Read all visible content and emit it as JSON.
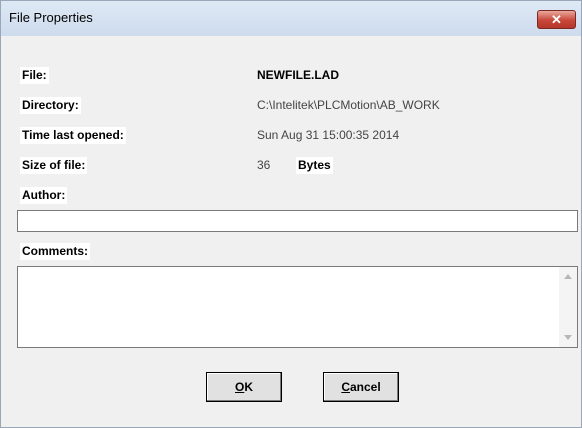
{
  "window": {
    "title": "File Properties",
    "close_glyph": "✕"
  },
  "fields": {
    "file_label": "File:",
    "file_value": "NEWFILE.LAD",
    "directory_label": "Directory:",
    "directory_value": "C:\\Intelitek\\PLCMotion\\AB_WORK",
    "time_label": "Time last opened:",
    "time_value": "Sun Aug 31 15:00:35 2014",
    "size_label": "Size of file:",
    "size_value": "36",
    "size_unit": "Bytes",
    "author_label": "Author:",
    "author_value": "",
    "comments_label": "Comments:",
    "comments_value": ""
  },
  "buttons": {
    "ok_mnemonic": "O",
    "ok_rest": "K",
    "cancel_mnemonic": "C",
    "cancel_rest": "ancel"
  },
  "icons": {
    "close": "close-icon",
    "scroll_up": "scroll-up-arrow-icon",
    "scroll_down": "scroll-down-arrow-icon"
  }
}
